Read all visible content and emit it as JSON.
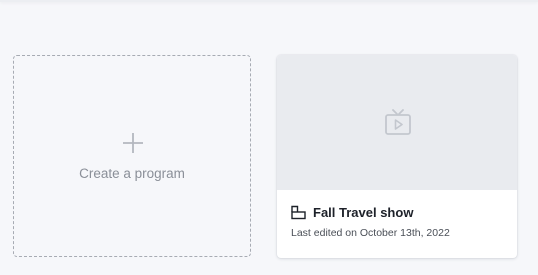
{
  "create_card": {
    "label": "Create a program",
    "icon": "plus-icon"
  },
  "programs": [
    {
      "title": "Fall Travel show",
      "meta": "Last edited on October 13th, 2022",
      "thumbnail_icon": "tv-icon",
      "type_icon": "program-icon"
    }
  ],
  "colors": {
    "page_bg": "#f6f7fa",
    "card_bg": "#ffffff",
    "thumb_bg": "#e9ebef",
    "dashed_border": "#a7abb3",
    "icon_muted": "#c3c7ce",
    "title_text": "#1d2129",
    "muted_text": "#8a8f98"
  }
}
